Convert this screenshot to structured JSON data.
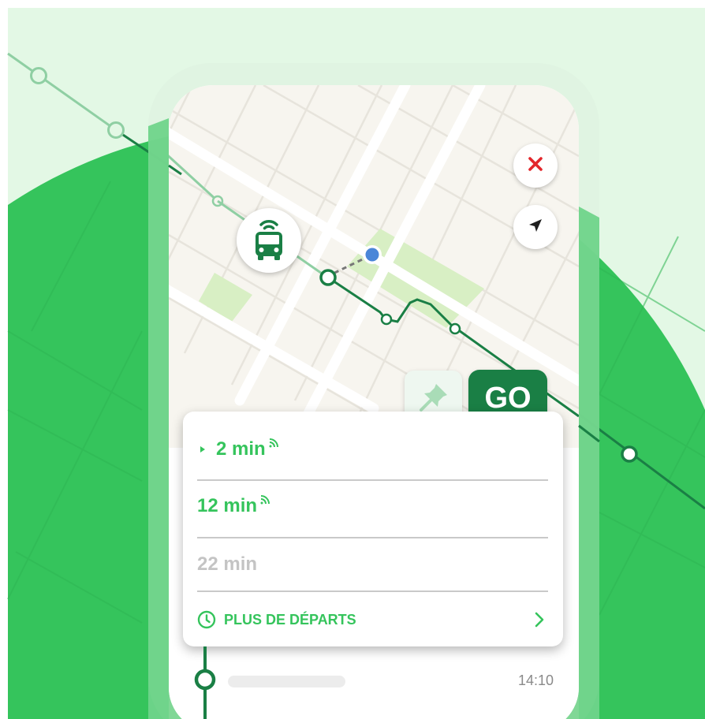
{
  "colors": {
    "bg_mint": "#e3f8e5",
    "brand_green": "#35c45c",
    "route_dark": "#1a7f45",
    "route_light": "#8fcfa3",
    "map_bg": "#f7f5ef",
    "park": "#d8efc4",
    "user_dot": "#4a86d8",
    "close_red": "#e3262b"
  },
  "map": {
    "close_icon": "close-icon",
    "locate_icon": "navigation-arrow-icon",
    "stop_icon": "bus-stop-icon",
    "user_location_icon": "user-location-dot"
  },
  "actions": {
    "pin_icon": "pushpin-icon",
    "go_label": "GO"
  },
  "departures": {
    "items": [
      {
        "time": "2 min",
        "realtime": true,
        "selected": true
      },
      {
        "time": "12 min",
        "realtime": true,
        "selected": false
      },
      {
        "time": "22 min",
        "realtime": false,
        "selected": false
      }
    ],
    "more_label": "PLUS DE DÉPARTS",
    "more_icon": "clock-icon",
    "more_chevron": "chevron-right-icon"
  },
  "timeline": {
    "time": "14:10"
  }
}
